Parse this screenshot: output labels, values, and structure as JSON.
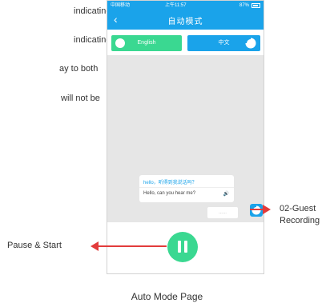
{
  "document": {
    "lines": [
      "indicating",
      "indicating",
      "ay to both",
      "will not be"
    ],
    "annotations": {
      "pause_start": "Pause & Start",
      "guest_recording_line1": "02-Guest",
      "guest_recording_line2": "Recording"
    },
    "caption": "Auto Mode Page",
    "arrow_color": "#e23b3b"
  },
  "app": {
    "status_bar": {
      "carrier": "中国移动",
      "time": "上午11:57",
      "battery": "87%"
    },
    "nav": {
      "back_icon": "chevron-left-icon",
      "title": "自动模式"
    },
    "language_buttons": {
      "english_label": "English",
      "chinese_label": "中文"
    },
    "chat": {
      "question_zh": "hello，听得到我说话吗？",
      "question_en": "Hello, can you hear me?",
      "speaker_icon": "speaker-icon",
      "guest_input_value": "……"
    },
    "colors": {
      "brand_blue": "#1aa3ea",
      "brand_green": "#3ad891",
      "chat_background": "#e6e6e6"
    }
  }
}
